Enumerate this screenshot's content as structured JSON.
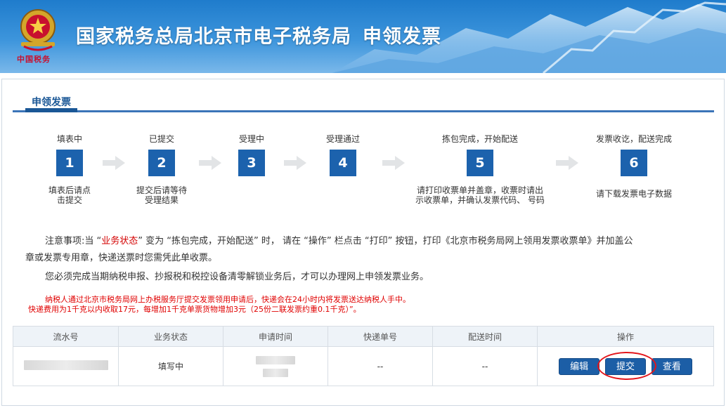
{
  "header": {
    "title": "国家税务总局北京市电子税务局",
    "subtitle": "申领发票",
    "emblem_text": "中国税务",
    "colors": {
      "banner": "#2f8ad6",
      "accent": "#1c62ad"
    }
  },
  "section": {
    "title": "申领发票"
  },
  "steps": [
    {
      "num": "1",
      "label": "填表中",
      "desc_lines": [
        "填表后请点",
        "击提交"
      ]
    },
    {
      "num": "2",
      "label": "已提交",
      "desc_lines": [
        "提交后请等待",
        "受理结果"
      ]
    },
    {
      "num": "3",
      "label": "受理中",
      "desc_lines": []
    },
    {
      "num": "4",
      "label": "受理通过",
      "desc_lines": []
    },
    {
      "num": "5",
      "label": "拣包完成，开始配送",
      "desc_lines": [
        "请打印收票单并盖章，收票时请出",
        "示收票单，并确认发票代码、 号码"
      ]
    },
    {
      "num": "6",
      "label": "发票收讫，配送完成",
      "desc_lines": [
        "请下载发票电子数据"
      ]
    }
  ],
  "notice": {
    "p1_a": "注意事项:当 “",
    "p1_hl": "业务状态",
    "p1_b": "” 变为 “拣包完成，开始配送” 时， 请在 “操作” 栏点击 “打印” 按钮，打印《北京市税务局网上领用发票收票单》并加盖公",
    "p1_c": "章或发票专用章，快递送票时您需凭此单收票。",
    "p2": "您必须完成当期纳税申报、抄报税和税控设备清零解锁业务后，才可以办理网上申领发票业务。",
    "red1": "纳税人通过北京市税务局网上办税服务厅提交发票领用申请后，快递会在24小时内将发票送达纳税人手中。",
    "red2": "快递费用为1千克以内收取17元，每增加1千克单票货物增加3元（25份二联发票约重0.1千克）”。"
  },
  "table": {
    "columns": [
      "流水号",
      "业务状态",
      "申请时间",
      "快递单号",
      "配送时间",
      "操作"
    ],
    "rows": [
      {
        "serial": "",
        "status": "填写中",
        "apply_time": "",
        "tracking": "--",
        "delivery_time": "--"
      }
    ],
    "actions": {
      "edit": "编辑",
      "submit": "提交",
      "view": "查看"
    }
  }
}
